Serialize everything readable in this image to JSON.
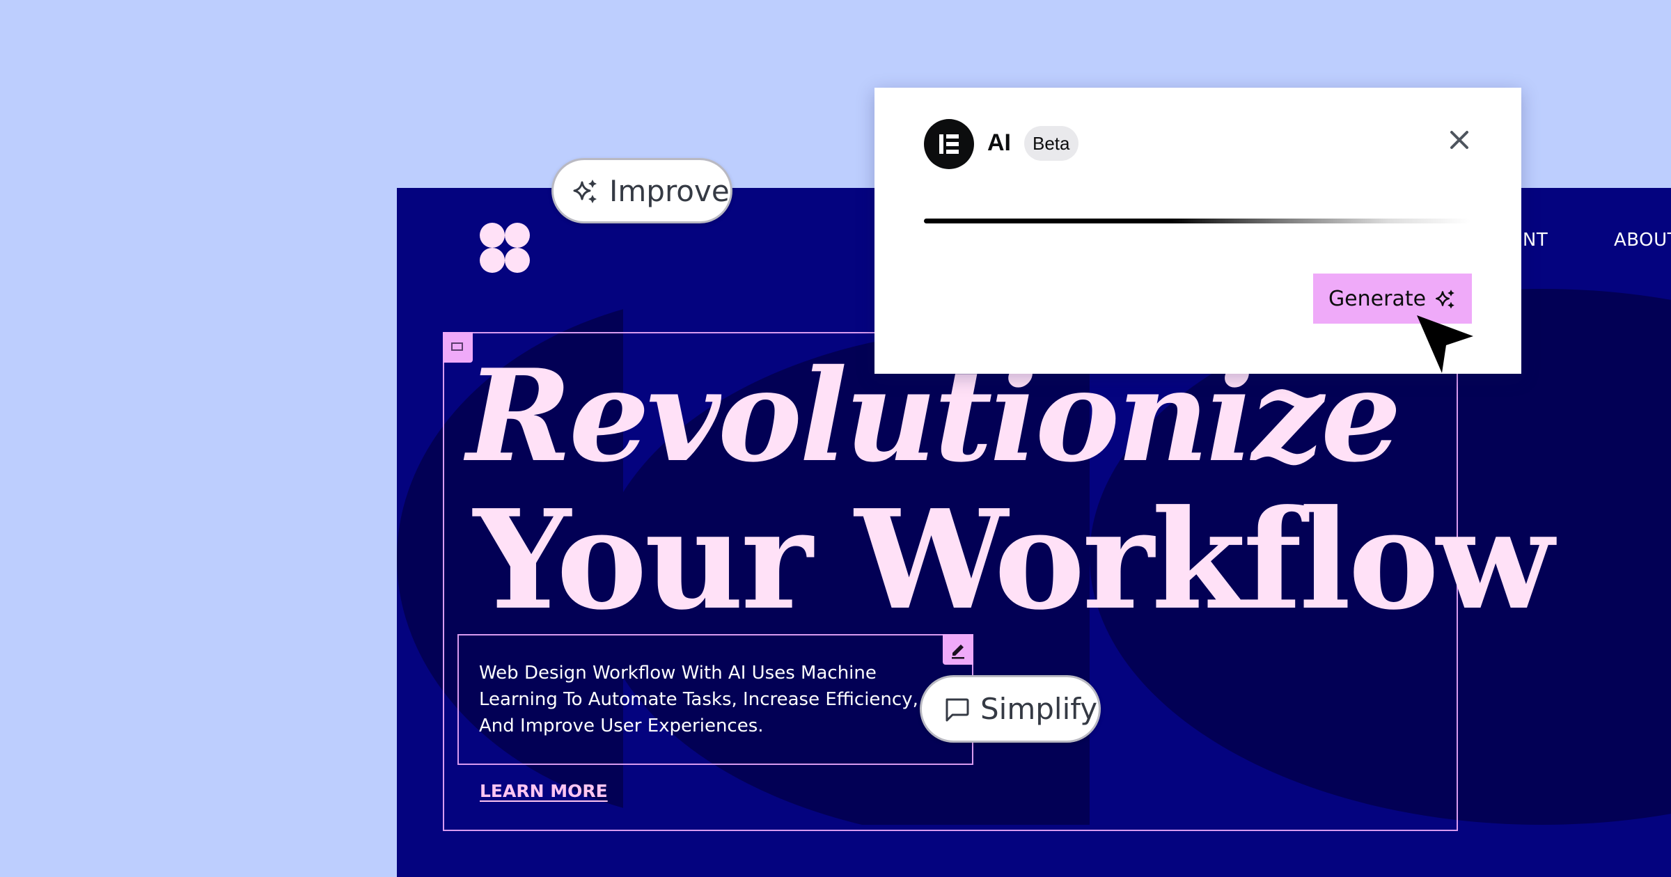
{
  "colors": {
    "page_background": "#BDCEFE",
    "canvas_blue": "#04037F",
    "canvas_dark": "#020055",
    "headline_pink": "#FFE1F7",
    "accent_pink": "#EFAAF9"
  },
  "site": {
    "logo_icon": "four-circles-logo",
    "nav": [
      "ENT",
      "ABOUT"
    ],
    "headline_line1": "Revolutionize",
    "headline_line2": "Your Workflow",
    "description": "Web Design Workflow With AI Uses Machine Learning To Automate Tasks, Increase Efficiency, And Improve User Experiences.",
    "cta": "LEARN MORE"
  },
  "editor": {
    "container_handle_icon": "container-icon",
    "text_handle_icon": "pencil-icon",
    "improve_label": "Improve",
    "simplify_label": "Simplify"
  },
  "ai_popup": {
    "logo_icon": "elementor-logo",
    "title": "AI",
    "badge": "Beta",
    "close_icon": "close-icon",
    "progress": "loading",
    "generate_label": "Generate"
  }
}
